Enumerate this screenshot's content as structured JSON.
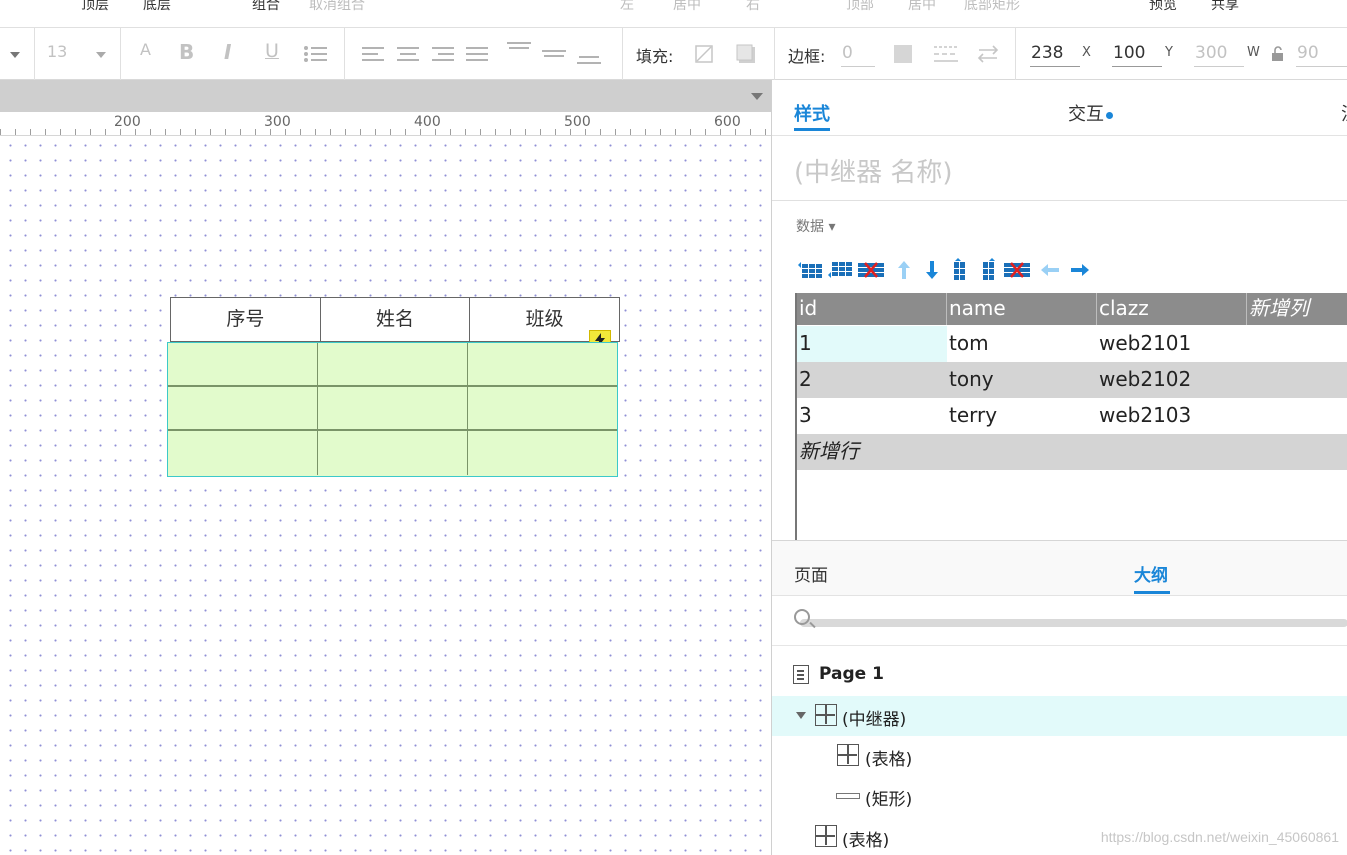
{
  "menu": {
    "items": [
      {
        "label": "顶层",
        "dim": false
      },
      {
        "label": "底层",
        "dim": false
      },
      {
        "label": "组合",
        "dim": false
      },
      {
        "label": "取消组合",
        "dim": true
      },
      {
        "label": "左",
        "dim": true
      },
      {
        "label": "居中",
        "dim": true
      },
      {
        "label": "右",
        "dim": true
      },
      {
        "label": "顶部",
        "dim": true
      },
      {
        "label": "居中",
        "dim": true
      },
      {
        "label": "底部矩形",
        "dim": true
      },
      {
        "label": "预览",
        "dim": false
      },
      {
        "label": "共享",
        "dim": false
      }
    ]
  },
  "toolbar": {
    "font_size": "13",
    "fill_label": "填充:",
    "border_label": "边框:",
    "border_value": "0",
    "x_value": "238",
    "x_label": "X",
    "y_value": "100",
    "y_label": "Y",
    "w_value": "300",
    "w_label": "W",
    "h_value": "90"
  },
  "ruler": {
    "labels": [
      "200",
      "300",
      "400",
      "500",
      "600"
    ]
  },
  "canvas": {
    "header_cells": [
      "序号",
      "姓名",
      "班级"
    ],
    "repeater_rows": 3
  },
  "panel": {
    "tabs": {
      "style": "样式",
      "interaction": "交互",
      "notes": "注"
    },
    "widget_name_placeholder": "(中继器 名称)",
    "data_label": "数据 ▾",
    "data_grid": {
      "columns": [
        "id",
        "name",
        "clazz"
      ],
      "add_column": "新增列",
      "rows": [
        [
          "1",
          "tom",
          "web2101"
        ],
        [
          "2",
          "tony",
          "web2102"
        ],
        [
          "3",
          "terry",
          "web2103"
        ]
      ],
      "add_row": "新增行"
    },
    "lower_tabs": {
      "pages": "页面",
      "outline": "大纲"
    },
    "outline": {
      "page": "Page 1",
      "repeater": "(中继器)",
      "table_child": "(表格)",
      "rect_child": "(矩形)",
      "table": "(表格)"
    }
  },
  "watermark": "https://blog.csdn.net/weixin_45060861",
  "colors": {
    "accent": "#1a86d8",
    "repeater_fill": "#e2fbcc",
    "repeater_border": "#3cc9c9",
    "selection": "#e2fafa"
  }
}
